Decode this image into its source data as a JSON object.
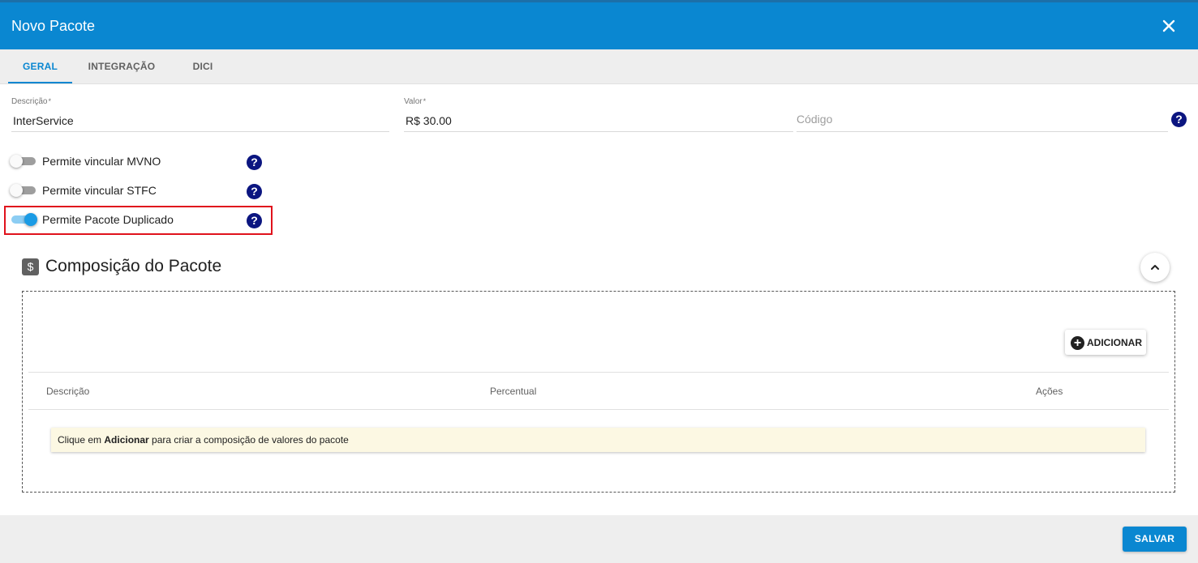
{
  "header": {
    "title": "Novo Pacote",
    "close_icon": "close-icon"
  },
  "tabs": [
    {
      "label": "GERAL",
      "active": true
    },
    {
      "label": "INTEGRAÇÃO",
      "active": false
    },
    {
      "label": "DICI",
      "active": false
    }
  ],
  "form": {
    "descricao": {
      "label": "Descrição",
      "required_mark": "*",
      "value": "InterService"
    },
    "valor": {
      "label": "Valor",
      "required_mark": "*",
      "value": "R$ 30.00"
    },
    "codigo": {
      "placeholder": "Código",
      "value": ""
    }
  },
  "toggles": [
    {
      "label": "Permite vincular MVNO",
      "on": false
    },
    {
      "label": "Permite vincular STFC",
      "on": false
    },
    {
      "label": "Permite Pacote Duplicado",
      "on": true
    }
  ],
  "help_symbol": "?",
  "composicao": {
    "icon_symbol": "$",
    "title": "Composição do Pacote",
    "add_button": {
      "plus": "+",
      "label": "ADICIONAR"
    },
    "columns": [
      "Descrição",
      "Percentual",
      "Ações"
    ],
    "empty_message": {
      "prefix": "Clique em ",
      "bold": "Adicionar",
      "suffix": " para criar a composição de valores do pacote"
    }
  },
  "footer": {
    "save_label": "SALVAR"
  },
  "colors": {
    "primary": "#0a87d1",
    "help_icon": "#0b1580",
    "highlight": "#e0121c",
    "info_bg": "#fcf8e3"
  }
}
